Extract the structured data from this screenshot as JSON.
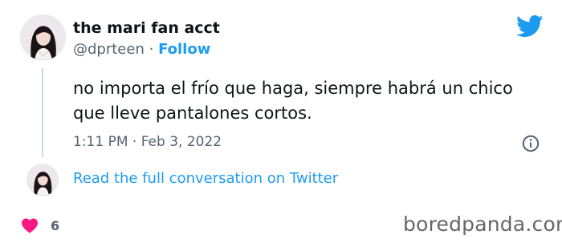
{
  "author": {
    "display_name": "the mari fan acct",
    "handle": "@dprteen",
    "separator": "·",
    "follow_label": "Follow"
  },
  "tweet": {
    "text": "no importa el frío que haga, siempre habrá un chico que lleve pantalones cortos.",
    "timestamp": "1:11 PM · Feb 3, 2022"
  },
  "conversation": {
    "link_label": "Read the full conversation on Twitter"
  },
  "engagement": {
    "likes": "6"
  },
  "watermark": "boredpanda.com",
  "colors": {
    "accent": "#1d9bf0",
    "heart": "#f91880",
    "muted": "#536471",
    "text": "#0f1419"
  },
  "icons": {
    "brand": "twitter-bird-icon",
    "info": "info-icon",
    "like": "heart-icon"
  }
}
